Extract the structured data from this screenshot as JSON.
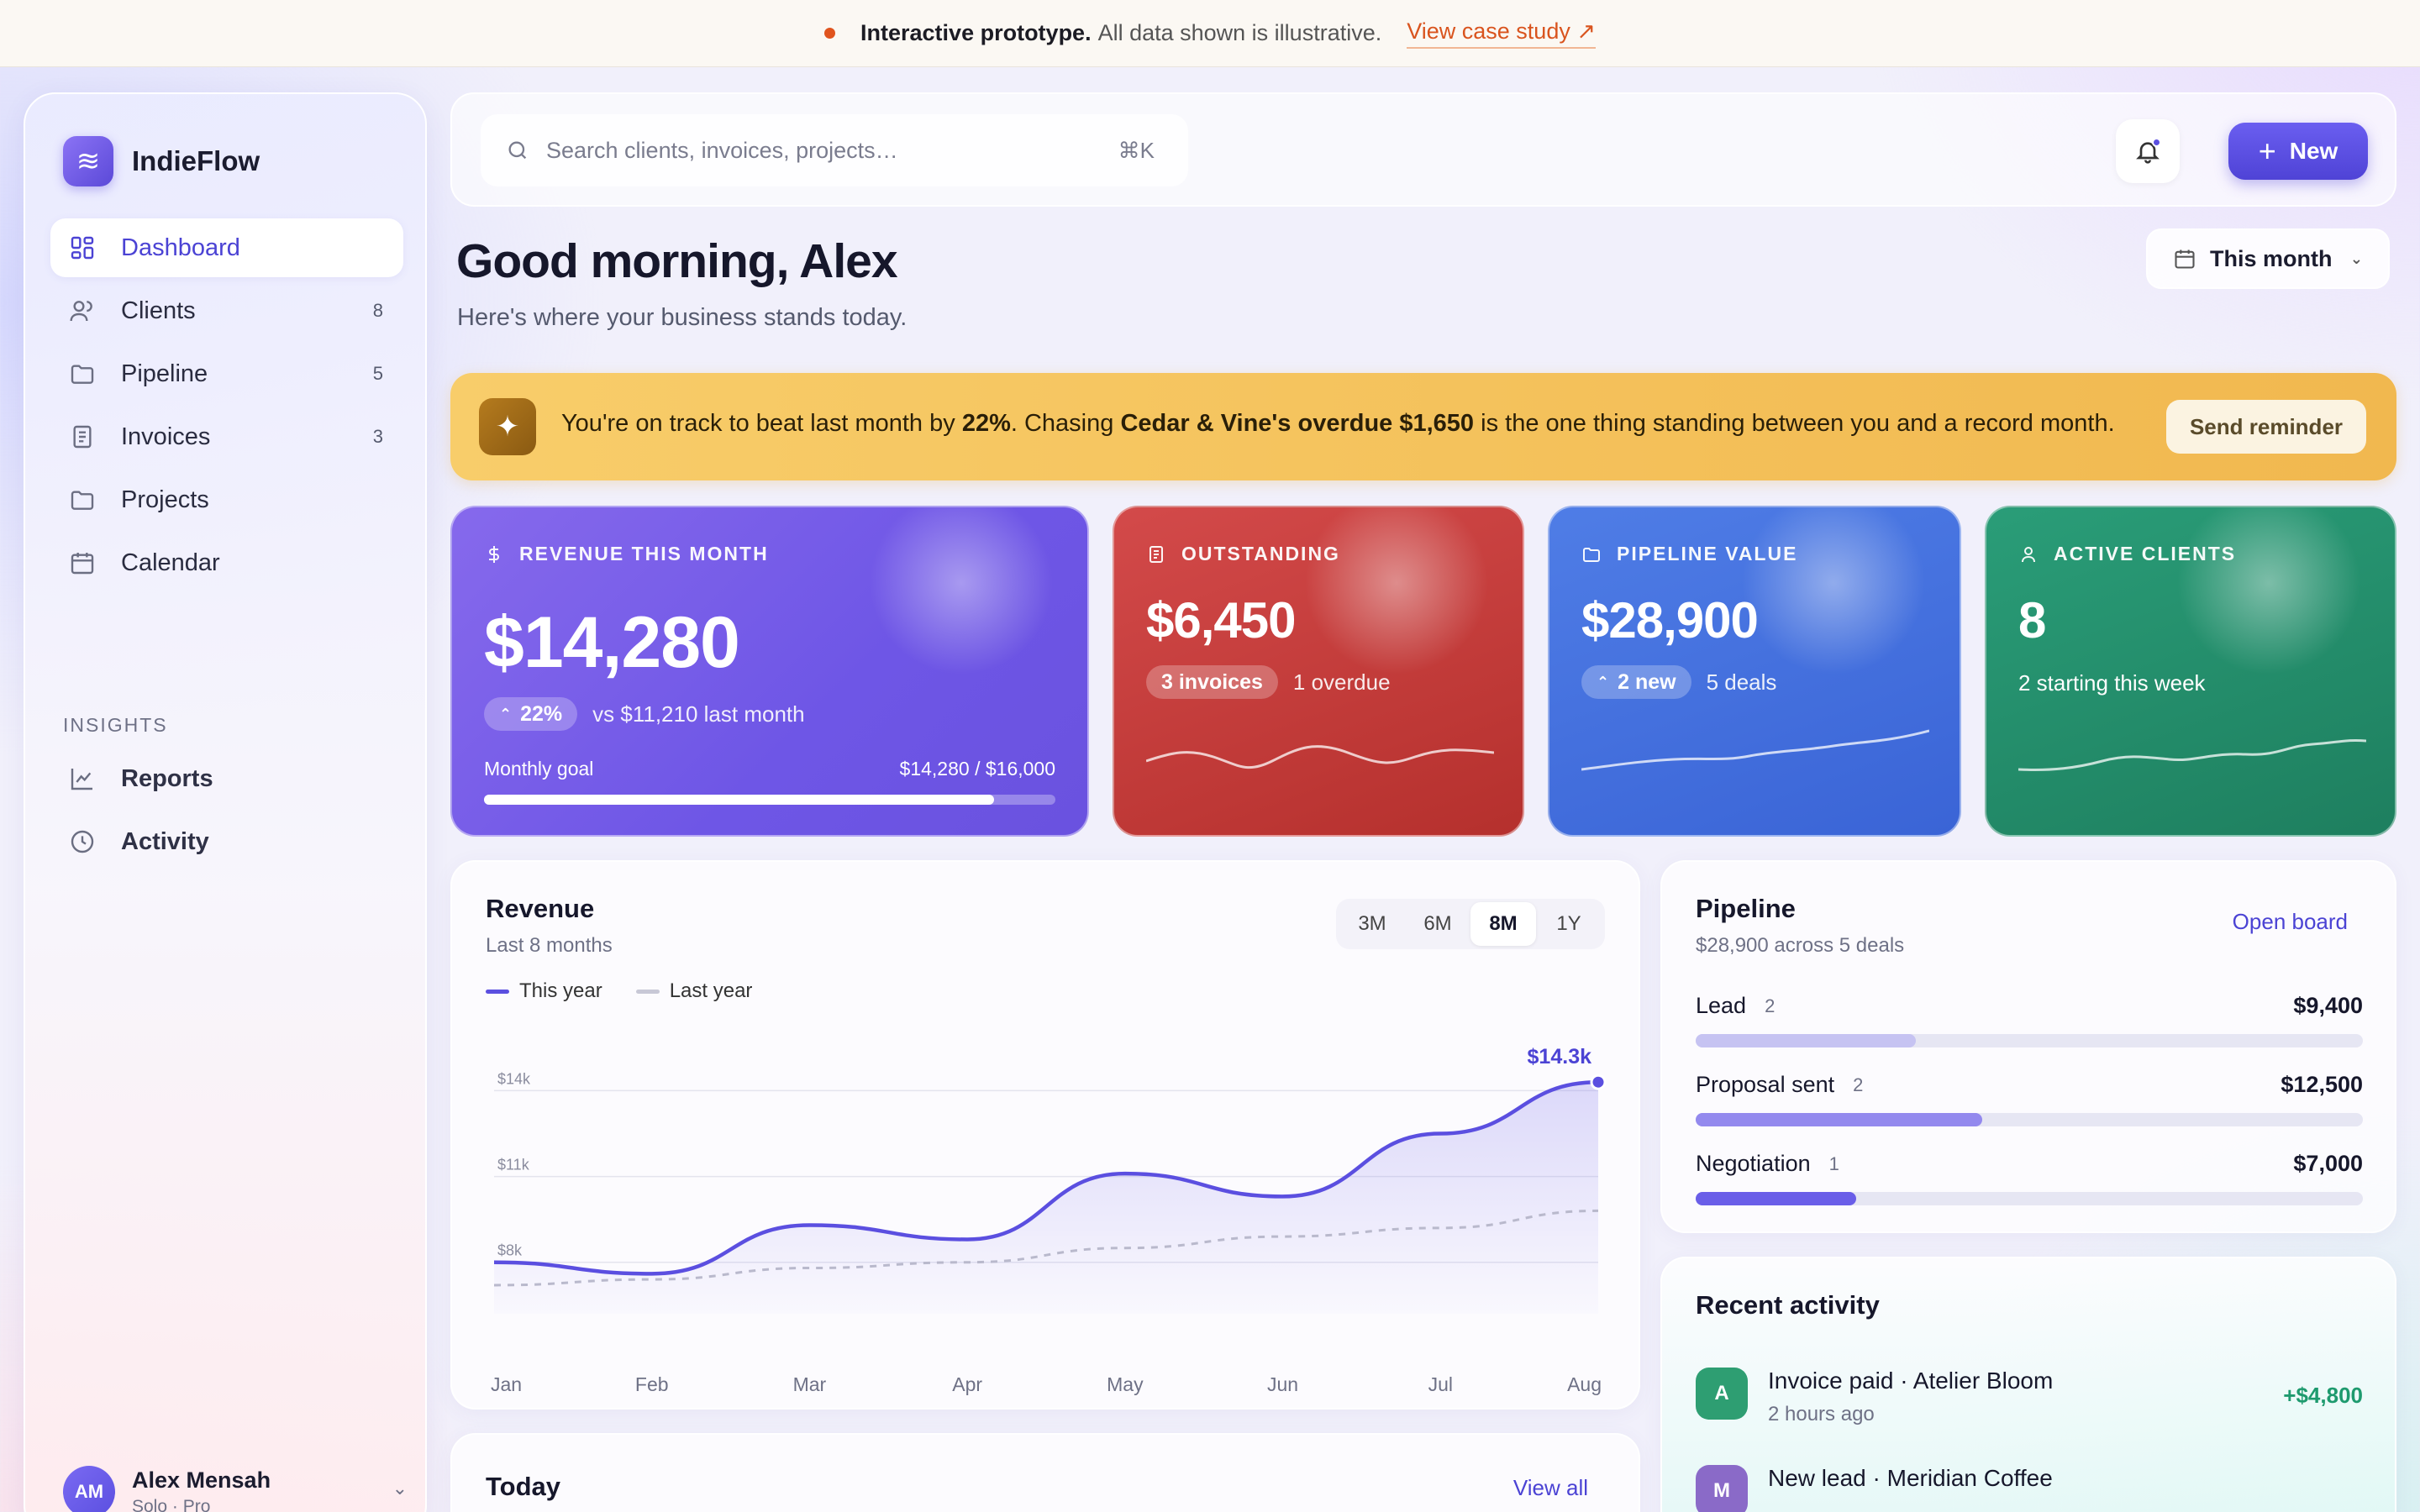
{
  "banner": {
    "strong": "Interactive prototype.",
    "text": "All data shown is illustrative.",
    "link": "View case study ↗"
  },
  "brand": {
    "name": "IndieFlow"
  },
  "nav": [
    {
      "label": "Dashboard",
      "count": ""
    },
    {
      "label": "Clients",
      "count": "8"
    },
    {
      "label": "Pipeline",
      "count": "5"
    },
    {
      "label": "Invoices",
      "count": "3"
    },
    {
      "label": "Projects",
      "count": ""
    },
    {
      "label": "Calendar",
      "count": ""
    }
  ],
  "insights_label": "INSIGHTS",
  "insights_nav": [
    {
      "label": "Reports"
    },
    {
      "label": "Activity"
    }
  ],
  "user": {
    "initials": "AM",
    "name": "Alex Mensah",
    "plan": "Solo · Pro"
  },
  "search": {
    "placeholder": "Search clients, invoices, projects…",
    "shortcut": "⌘K"
  },
  "new_button": "New",
  "greeting": "Good morning, Alex",
  "subtitle": "Here's where your business stands today.",
  "period": "This month",
  "insight": {
    "t1": "You're on track to beat last month by ",
    "b1": "22%",
    "t2": ". Chasing ",
    "b2": "Cedar & Vine's overdue $1,650",
    "t3": " is the one thing standing between you and a record month.",
    "button": "Send reminder"
  },
  "kpis": {
    "revenue": {
      "label": "REVENUE THIS MONTH",
      "value": "$14,280",
      "pill": "22%",
      "meta": "vs $11,210 last month",
      "goal_label": "Monthly goal",
      "goal_value": "$14,280 / $16,000",
      "goal_fraction": 0.8925
    },
    "outstanding": {
      "label": "OUTSTANDING",
      "value": "$6,450",
      "pill": "3 invoices",
      "meta": "1 overdue"
    },
    "pipeline": {
      "label": "PIPELINE VALUE",
      "value": "$28,900",
      "pill": "2 new",
      "meta": "5 deals"
    },
    "clients": {
      "label": "ACTIVE CLIENTS",
      "value": "8",
      "meta": "2 starting this week"
    }
  },
  "revenue_panel": {
    "title": "Revenue",
    "subtitle": "Last 8 months",
    "ranges": [
      "3M",
      "6M",
      "8M",
      "1Y"
    ],
    "active_range": "8M",
    "legend_this": "This year",
    "legend_last": "Last year",
    "peak_label": "$14.3k"
  },
  "chart_data": {
    "type": "area",
    "x": [
      "Jan",
      "Feb",
      "Mar",
      "Apr",
      "May",
      "Jun",
      "Jul",
      "Aug"
    ],
    "series": [
      {
        "name": "This year",
        "values": [
          8.0,
          7.6,
          9.3,
          8.8,
          11.1,
          10.3,
          12.5,
          14.3
        ],
        "color": "#5b4fe0"
      },
      {
        "name": "Last year",
        "values": [
          7.2,
          7.4,
          7.8,
          8.0,
          8.5,
          8.9,
          9.2,
          9.8
        ],
        "color": "#b9b9cc"
      }
    ],
    "yticks": [
      "$8k",
      "$11k",
      "$14k"
    ],
    "ytick_values": [
      8,
      11,
      14
    ],
    "ylim": [
      6.2,
      14.6
    ],
    "grid": true,
    "legend": "top-left"
  },
  "pipeline_panel": {
    "title": "Pipeline",
    "subtitle": "$28,900 across 5 deals",
    "link": "Open board",
    "stages": [
      {
        "name": "Lead",
        "count": "2",
        "amount": "$9,400",
        "fraction": 0.33,
        "color": "#c6c3f2"
      },
      {
        "name": "Proposal sent",
        "count": "2",
        "amount": "$12,500",
        "fraction": 0.43,
        "color": "#9389ee"
      },
      {
        "name": "Negotiation",
        "count": "1",
        "amount": "$7,000",
        "fraction": 0.24,
        "color": "#6a5ee8"
      }
    ]
  },
  "activity": {
    "title": "Recent activity",
    "items": [
      {
        "initial": "A",
        "title": "Invoice paid · Atelier Bloom",
        "time": "2 hours ago",
        "amount": "+$4,800",
        "color": "#2e9e72"
      },
      {
        "initial": "M",
        "title": "New lead · Meridian Coffee",
        "time": "",
        "amount": "",
        "color": "#8a6ac8"
      }
    ]
  },
  "today": {
    "title": "Today",
    "link": "View all"
  }
}
